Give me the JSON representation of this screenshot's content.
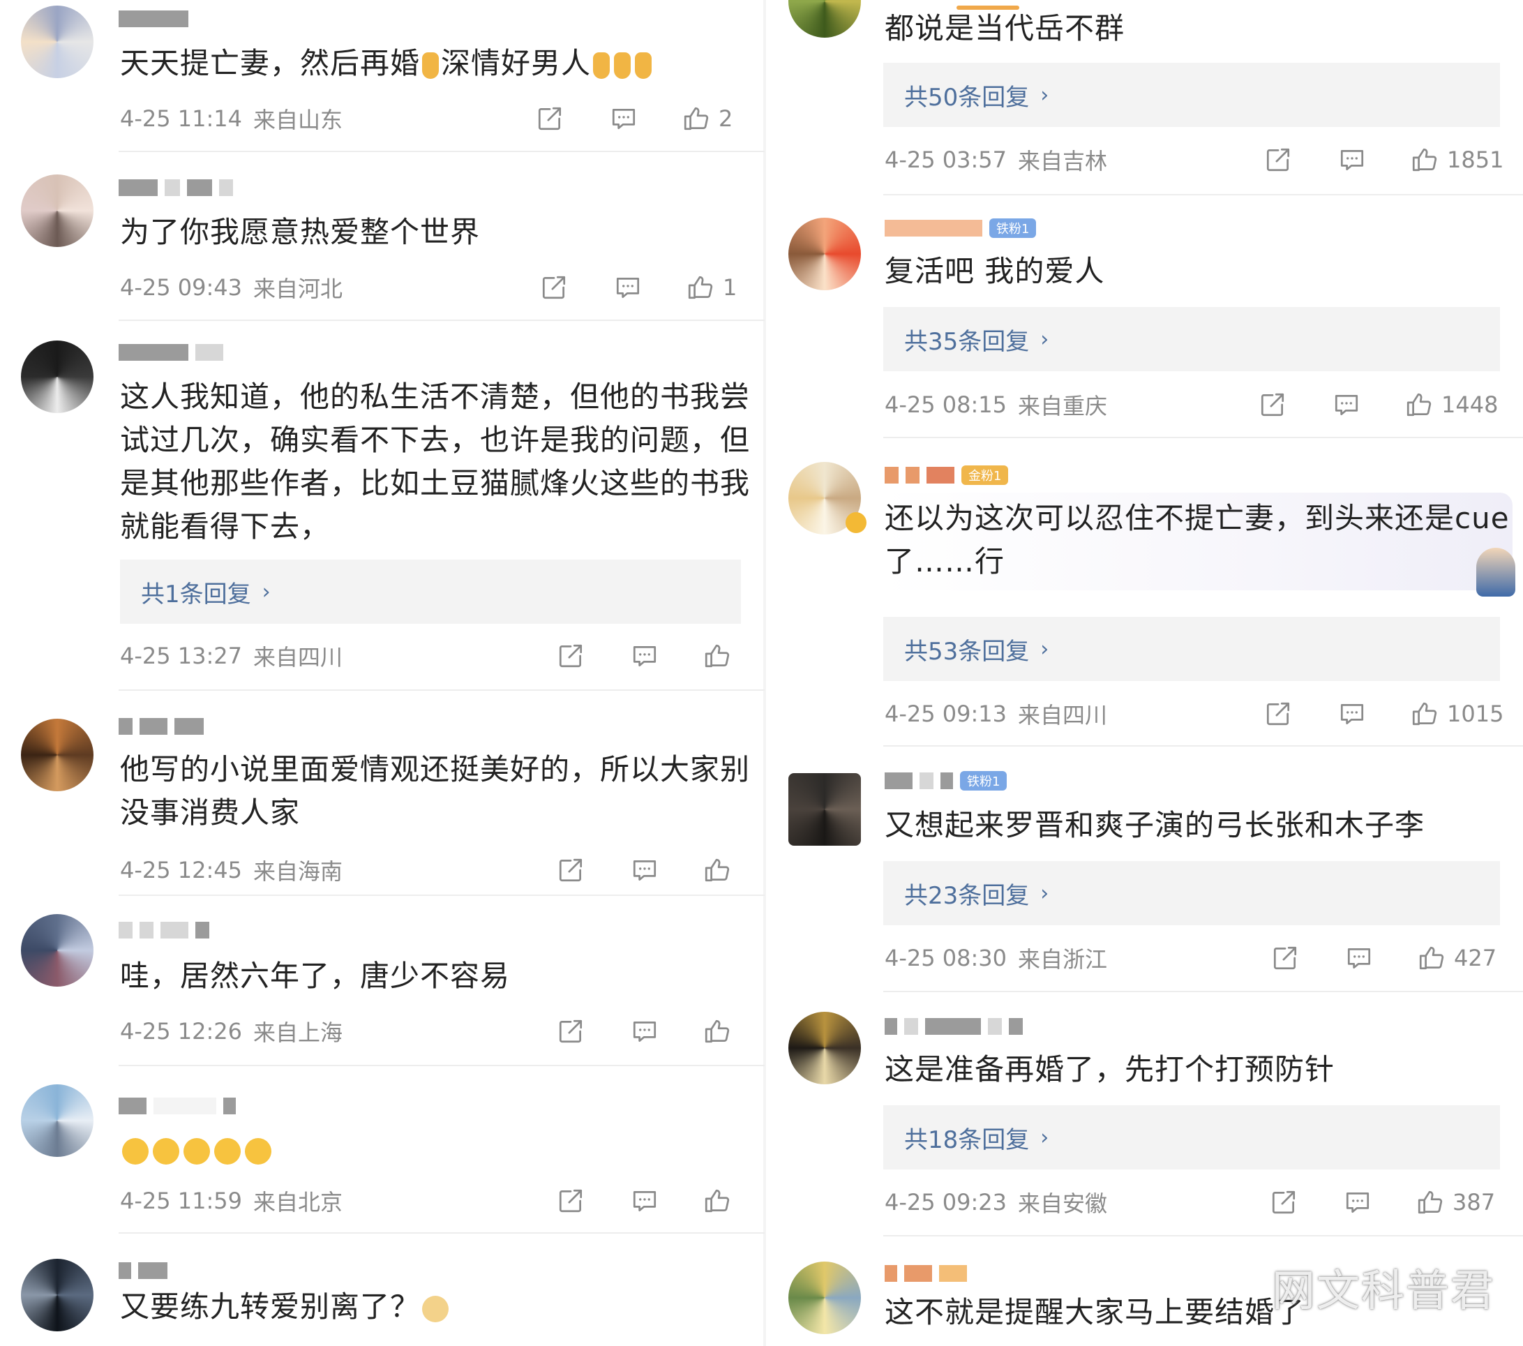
{
  "left": {
    "comments": [
      {
        "text": [
          "天天提亡妻，然后再婚",
          "深情好男人"
        ],
        "time": "4-25 11:14",
        "loc": "来自山东",
        "likes": "2"
      },
      {
        "text": [
          "为了你我愿意热爱整个世界"
        ],
        "time": "4-25 09:43",
        "loc": "来自河北",
        "likes": "1"
      },
      {
        "text": [
          "这人我知道，他的私生活不清楚，但他的书我尝",
          "试过几次，确实看不下去，也许是我的问题，但",
          "是其他那些作者，比如土豆猫腻烽火这些的书我",
          "就能看得下去，"
        ],
        "reply": "共1条回复",
        "time": "4-25 13:27",
        "loc": "来自四川",
        "likes": ""
      },
      {
        "text": [
          "他写的小说里面爱情观还挺美好的，所以大家别",
          "没事消费人家"
        ],
        "time": "4-25 12:45",
        "loc": "来自海南",
        "likes": ""
      },
      {
        "text": [
          "哇，居然六年了，唐少不容易"
        ],
        "time": "4-25 12:26",
        "loc": "来自上海",
        "likes": ""
      },
      {
        "text": [
          ""
        ],
        "time": "4-25 11:59",
        "loc": "来自北京",
        "likes": ""
      },
      {
        "text": [
          "又要练九转爱别离了？"
        ]
      }
    ]
  },
  "right": {
    "comments": [
      {
        "text": [
          "都说是当代岳不群"
        ],
        "reply": "共50条回复",
        "time": "4-25 03:57",
        "loc": "来自吉林",
        "likes": "1851"
      },
      {
        "badge": "铁粉1",
        "text": [
          "复活吧 我的爱人"
        ],
        "reply": "共35条回复",
        "time": "4-25 08:15",
        "loc": "来自重庆",
        "likes": "1448"
      },
      {
        "badge": "金粉1",
        "text": [
          "还以为这次可以忍住不提亡妻，到头来还是cue",
          "了……行"
        ],
        "reply": "共53条回复",
        "time": "4-25 09:13",
        "loc": "来自四川",
        "likes": "1015"
      },
      {
        "badge": "铁粉1",
        "text": [
          "又想起来罗晋和爽子演的弓长张和木子李"
        ],
        "reply": "共23条回复",
        "time": "4-25 08:30",
        "loc": "来自浙江",
        "likes": "427"
      },
      {
        "text": [
          "这是准备再婚了，先打个打预防针"
        ],
        "reply": "共18条回复",
        "time": "4-25 09:23",
        "loc": "来自安徽",
        "likes": "387"
      },
      {
        "text": [
          "这不就是提醒大家马上要结婚了"
        ]
      }
    ]
  },
  "watermark": "网文科普君",
  "icons": {
    "share": "share-icon",
    "comment": "comment-icon",
    "like": "thumbs-up-icon",
    "chevron": "chevron-right-icon"
  },
  "colors": {
    "reply_link": "#4e6f9c",
    "meta_gray": "#8a8a8a",
    "reply_bg": "#f3f3f3",
    "fan_badge": "#7aa7e6",
    "gold_badge": "#f0b64b"
  }
}
